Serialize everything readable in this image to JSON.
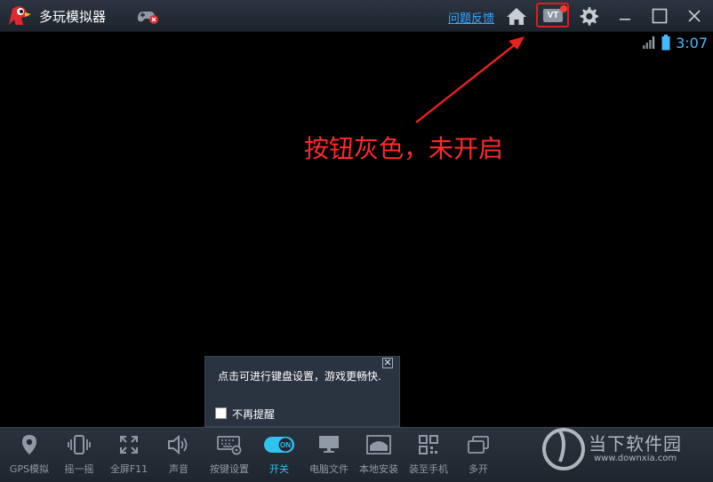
{
  "window": {
    "title": "多玩模拟器",
    "feedback_link": "问题反馈",
    "vt_badge": "VT"
  },
  "status": {
    "time": "3:07"
  },
  "annotation": {
    "text": "按钮灰色，未开启"
  },
  "tooltip": {
    "text": "点击可进行键盘设置，游戏更畅快.",
    "checkbox_label": "不再提醒",
    "close": "✕"
  },
  "toolbar": {
    "items": [
      {
        "label": "GPS模拟",
        "icon": "location-pin-icon"
      },
      {
        "label": "摇一摇",
        "icon": "shake-icon"
      },
      {
        "label": "全屏F11",
        "icon": "fullscreen-icon"
      },
      {
        "label": "声音",
        "icon": "speaker-icon"
      },
      {
        "label": "按键设置",
        "icon": "keyboard-settings-icon"
      },
      {
        "label": "开关",
        "icon": "toggle-on-icon"
      },
      {
        "label": "电脑文件",
        "icon": "monitor-icon"
      },
      {
        "label": "本地安装",
        "icon": "apk-install-icon"
      },
      {
        "label": "装至手机",
        "icon": "qr-code-icon"
      },
      {
        "label": "多开",
        "icon": "multi-window-icon"
      }
    ],
    "toggle_text": "ON"
  },
  "watermark": {
    "cn": "当下软件园",
    "en": "www.downxia.com"
  },
  "colors": {
    "accent": "#2ec4f0",
    "annotation": "#ff2a2a",
    "link": "#3aa6ff"
  }
}
